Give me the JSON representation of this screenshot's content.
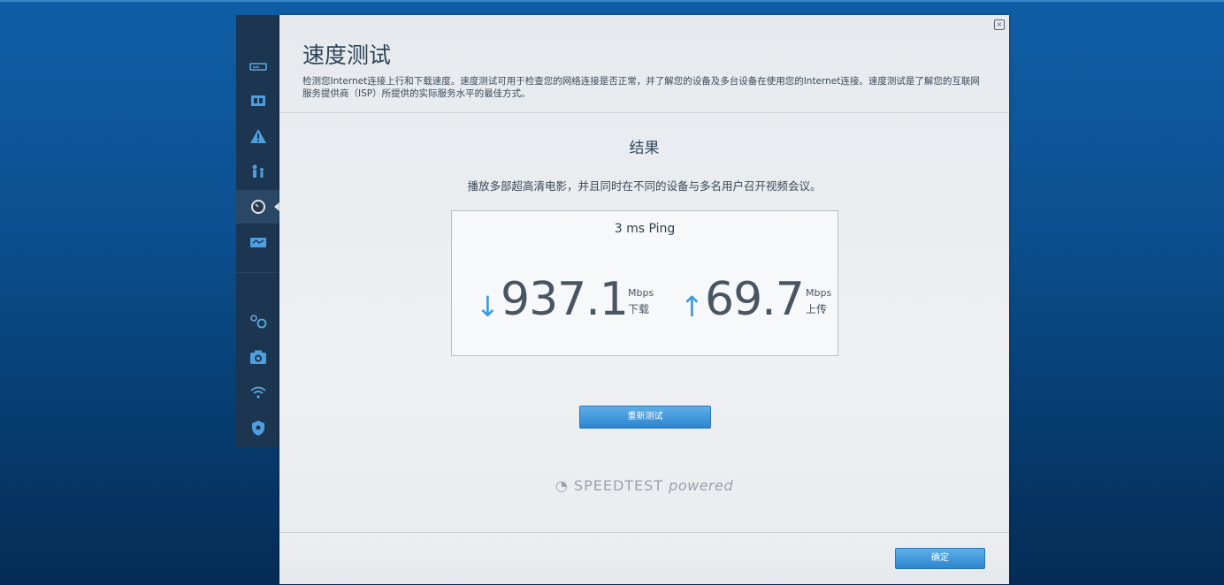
{
  "dialog": {
    "title": "速度测试",
    "description": "检测您Internet连接上行和下载速度。速度测试可用于检查您的网络连接是否正常，并了解您的设备及多台设备在使用您的Internet连接。速度测试是了解您的互联网服务提供商（ISP）所提供的实际服务水平的最佳方式。",
    "close_label": "×"
  },
  "result": {
    "heading": "结果",
    "subtitle": "播放多部超高清电影，并且同时在不同的设备与多名用户召开视频会议。",
    "ping": "3 ms Ping",
    "download": {
      "arrow": "↓",
      "value": "937.1",
      "unit": "Mbps",
      "label": "下载"
    },
    "upload": {
      "arrow": "↑",
      "value": "69.7",
      "unit": "Mbps",
      "label": "上传"
    }
  },
  "buttons": {
    "retest": "重新测试",
    "ok": "确定"
  },
  "branding": {
    "speedtest": "SPEEDTEST",
    "powered": "powered"
  },
  "sidebar": {
    "items": [
      {
        "icon": "router-icon"
      },
      {
        "icon": "devices-icon"
      },
      {
        "icon": "warning-icon"
      },
      {
        "icon": "parental-controls-icon"
      },
      {
        "icon": "speedometer-icon",
        "active": true
      },
      {
        "icon": "external-storage-icon"
      },
      {
        "icon": "connectivity-icon"
      },
      {
        "icon": "camera-icon"
      },
      {
        "icon": "wifi-icon"
      },
      {
        "icon": "security-shield-icon"
      }
    ]
  },
  "colors": {
    "accent": "#2c86cf",
    "sidebar": "#1c3550",
    "background": "#0b4f8f"
  }
}
